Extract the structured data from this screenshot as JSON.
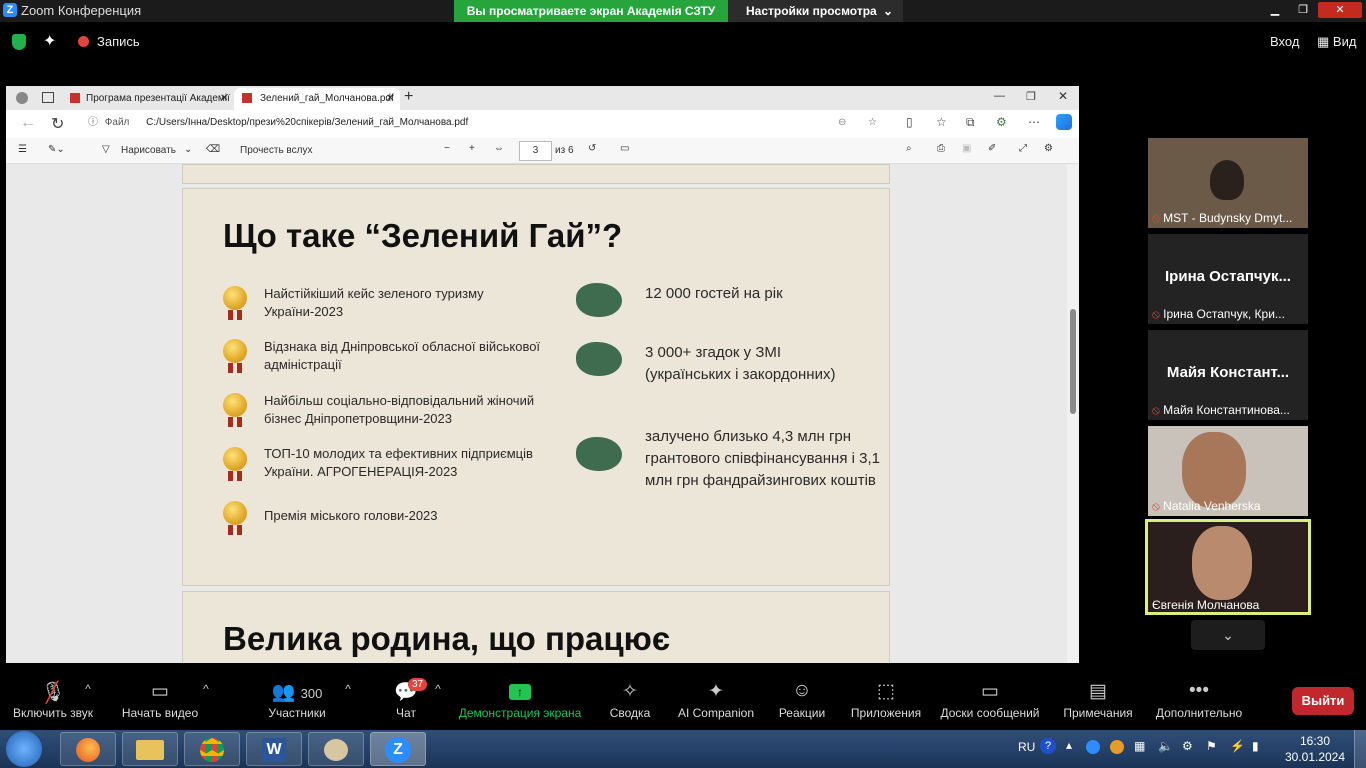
{
  "zoom": {
    "window_title": "Zoom Конференция",
    "share_banner": "Вы просматриваете экран Академія СЗТУ",
    "view_settings": "Настройки просмотра",
    "record_label": "Запись",
    "login_label": "Вход",
    "view_label": "Вид"
  },
  "browser": {
    "tabs": [
      {
        "label": "Програма презентації Академії"
      },
      {
        "label": "Зелений_гай_Молчанова.pdf"
      }
    ],
    "address_prefix": "Файл",
    "address": "C:/Users/Інна/Desktop/прези%20спікерів/Зелений_гай_Молчанова.pdf",
    "pdf": {
      "draw_label": "Нарисовать",
      "read_aloud_label": "Прочесть вслух",
      "page_value": "3",
      "page_total": "из 6"
    }
  },
  "slide": {
    "title": "Що таке “Зелений Гай”?",
    "achievements": [
      "Найстійкіший кейс зеленого туризму України-2023",
      "Відзнака від Дніпровської обласної військової адміністрації",
      "Найбільш соціально-відповідальний жіночий бізнес Дніпропетровщини-2023",
      "ТОП-10 молодих та ефективних підприємців України. АГРОГЕНЕРАЦІЯ-2023",
      "Премія міського голови-2023"
    ],
    "stats": [
      "12 000 гостей на рік",
      "3 000+ згадок у ЗМІ (українських і закордонних)",
      "залучено близько 4,3 млн грн грантового співфінансування і 3,1 млн грн фандрайзингових коштів"
    ],
    "next_title": "Велика родина, що працює"
  },
  "participants": [
    {
      "name": "MST - Budynsky Dmyt..."
    },
    {
      "big": "Ірина  Остапчук...",
      "name": "Ірина Остапчук, Кри..."
    },
    {
      "big": "Майя  Констант...",
      "name": "Майя Константинова..."
    },
    {
      "name": "Natalia Venherska"
    },
    {
      "name": "Євгенія Молчанова"
    }
  ],
  "toolbar": {
    "unmute": "Включить звук",
    "start_video": "Начать видео",
    "participants_count": "300",
    "participants": "Участники",
    "chat_badge": "37",
    "chat": "Чат",
    "share": "Демонстрация экрана",
    "summary": "Сводка",
    "ai": "AI Companion",
    "reactions": "Реакции",
    "apps": "Приложения",
    "whiteboards": "Доски сообщений",
    "notes": "Примечания",
    "more": "Дополнительно",
    "leave": "Выйти"
  },
  "taskbar": {
    "lang": "RU",
    "time": "16:30",
    "date": "30.01.2024"
  }
}
